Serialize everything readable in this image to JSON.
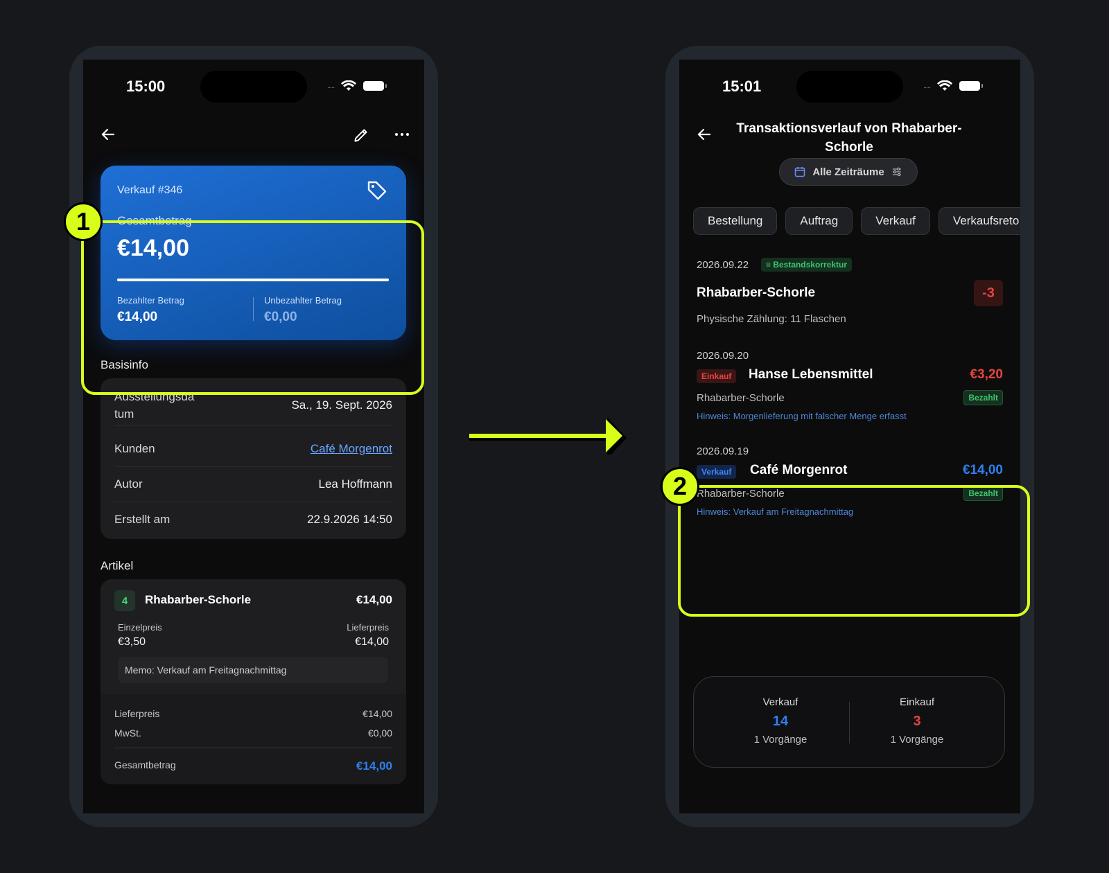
{
  "screen1": {
    "status": {
      "time": "15:00",
      "dots": "....."
    },
    "icons": {
      "back": "arrow-left-icon",
      "edit": "pencil-icon",
      "more": "more-horizontal-icon",
      "tag": "tag-icon"
    },
    "sale_card": {
      "label": "Verkauf #346",
      "caption": "Gesamtbetrag",
      "total": "€14,00",
      "paid_fraction": 1.0,
      "paid_label": "Bezahlter Betrag",
      "paid_value": "€14,00",
      "unpaid_label": "Unbezahlter Betrag",
      "unpaid_value": "€0,00"
    },
    "basisinfo": {
      "title": "Basisinfo",
      "rows": [
        {
          "label": "Ausstellungsda\ntum",
          "value": "Sa., 19. Sept. 2026"
        },
        {
          "label": "Kunden",
          "value": "Café Morgenrot"
        },
        {
          "label": "Autor",
          "value": "Lea Hoffmann"
        },
        {
          "label": "Erstellt am",
          "value": "22.9.2026 14:50"
        }
      ]
    },
    "artikel": {
      "title": "Artikel",
      "qty": "4",
      "name": "Rhabarber-Schorle",
      "price": "€14,00",
      "unit_label": "Einzelpreis",
      "unit_value": "€3,50",
      "delivery_label": "Lieferpreis",
      "delivery_value": "€14,00",
      "memo": "Memo: Verkauf am Freitagnachmittag",
      "summary": [
        {
          "label": "Lieferpreis",
          "value": "€14,00"
        },
        {
          "label": "MwSt.",
          "value": "€0,00"
        },
        {
          "label": "Gesamtbetrag",
          "value": "€14,00"
        }
      ]
    }
  },
  "screen2": {
    "status": {
      "time": "15:01",
      "dots": "....."
    },
    "title": "Transaktionsverlauf von Rhabarber-Schorle",
    "filter": {
      "label": "Alle Zeiträume",
      "icon": "calendar-icon",
      "settings_icon": "sliders-icon"
    },
    "tabs": [
      "Bestellung",
      "Auftrag",
      "Verkauf",
      "Verkaufsreto"
    ],
    "transactions": [
      {
        "date": "2026.09.22",
        "badge": "Bestandskorrektur",
        "title": "Rhabarber-Schorle",
        "amount": "-3",
        "sub": "Physische Zählung: 11 Flaschen"
      },
      {
        "date": "2026.09.20",
        "badge": "Einkauf",
        "title": "Hanse Lebensmittel",
        "amount": "€3,20",
        "sub": "Rhabarber-Schorle",
        "status": "Bezahlt",
        "note": "Hinweis: Morgenlieferung mit falscher Menge erfasst"
      },
      {
        "date": "2026.09.19",
        "badge": "Verkauf",
        "title": "Café Morgenrot",
        "amount": "€14,00",
        "sub": "Rhabarber-Schorle",
        "status": "Bezahlt",
        "note": "Hinweis: Verkauf am Freitagnachmittag"
      }
    ],
    "stats": [
      {
        "label": "Verkauf",
        "value": "14",
        "count": "1 Vorgänge"
      },
      {
        "label": "Einkauf",
        "value": "3",
        "count": "1 Vorgänge"
      }
    ]
  },
  "annotations": {
    "marker1": "1",
    "marker2": "2"
  },
  "colors": {
    "accent": "#d8ff1a",
    "blue": "#3c86ff",
    "red": "#e8433f",
    "green": "#3ec46d"
  }
}
